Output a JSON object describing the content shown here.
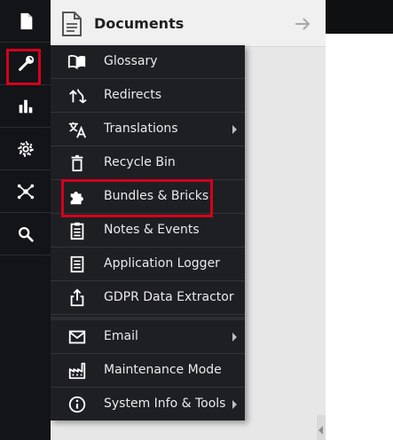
{
  "rail": {
    "items": [
      {
        "icon": "document-icon"
      },
      {
        "icon": "wrench-icon",
        "highlighted": true
      },
      {
        "icon": "bar-chart-icon"
      },
      {
        "icon": "gear-icon"
      },
      {
        "icon": "network-icon"
      },
      {
        "icon": "search-icon"
      }
    ]
  },
  "documents": {
    "title": "Documents",
    "icon": "document-outline-icon",
    "collapse_icon": "arrow-right-icon"
  },
  "menu": {
    "items": [
      {
        "label": "Glossary",
        "icon": "book-icon"
      },
      {
        "label": "Redirects",
        "icon": "redirect-icon"
      },
      {
        "label": "Translations",
        "icon": "translate-icon",
        "submenu": true
      },
      {
        "label": "Recycle Bin",
        "icon": "trash-icon"
      },
      {
        "label": "Bundles & Bricks",
        "icon": "puzzle-icon",
        "highlighted": true
      },
      {
        "label": "Notes & Events",
        "icon": "clipboard-icon"
      },
      {
        "label": "Application Logger",
        "icon": "log-icon"
      },
      {
        "label": "GDPR Data Extractor",
        "icon": "export-icon"
      },
      {
        "label": "Email",
        "icon": "mail-icon",
        "submenu": true
      },
      {
        "label": "Maintenance Mode",
        "icon": "factory-icon"
      },
      {
        "label": "System Info & Tools",
        "icon": "info-icon",
        "submenu": true
      }
    ]
  },
  "colors": {
    "highlight": "#d4001e",
    "menu_bg": "#1e1f23",
    "rail_bg": "#131417",
    "menu_text": "#eaeaea"
  }
}
